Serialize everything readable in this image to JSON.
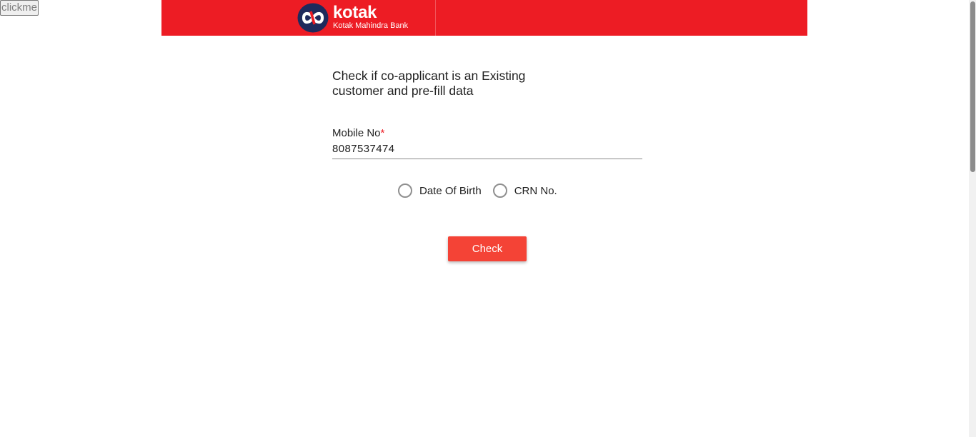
{
  "debug": {
    "clickme_label": "clickme"
  },
  "header": {
    "logo_word": "kotak",
    "logo_subtitle": "Kotak Mahindra Bank",
    "brand_color": "#ed1c24"
  },
  "form": {
    "title": "Check if co-applicant is an Existing customer and pre-fill data",
    "mobile": {
      "label": "Mobile No",
      "required_marker": "*",
      "value": "8087537474"
    },
    "lookup_options": [
      {
        "label": "Date Of Birth",
        "selected": false
      },
      {
        "label": "CRN No.",
        "selected": false
      }
    ],
    "check_button": "Check",
    "button_color": "#f44336"
  }
}
